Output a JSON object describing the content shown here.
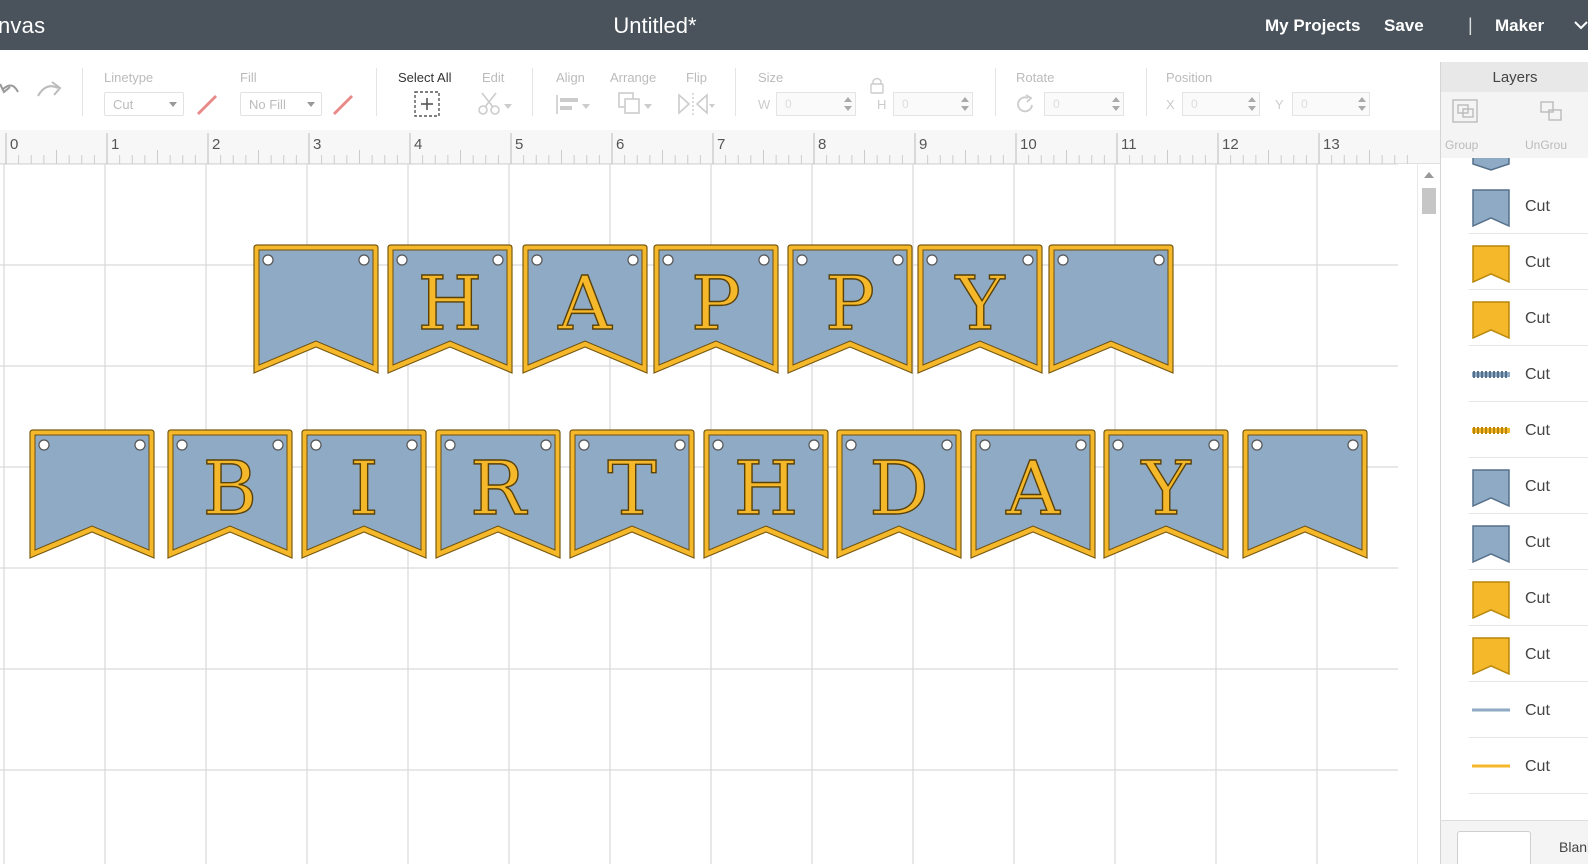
{
  "header": {
    "app_name": "nvas",
    "doc_title": "Untitled*",
    "my_projects": "My Projects",
    "save": "Save",
    "separator": "|",
    "machine": "Maker"
  },
  "toolbar": {
    "linetype_label": "Linetype",
    "linetype_value": "Cut",
    "fill_label": "Fill",
    "fill_value": "No Fill",
    "select_all_label": "Select All",
    "edit_label": "Edit",
    "align_label": "Align",
    "arrange_label": "Arrange",
    "flip_label": "Flip",
    "size_label": "Size",
    "w_label": "W",
    "h_label": "H",
    "rotate_label": "Rotate",
    "position_label": "Position",
    "x_label": "X",
    "y_label": "Y",
    "w_value": "0",
    "h_value": "0",
    "rotate_value": "0",
    "x_value": "0",
    "y_value": "0",
    "disabled_color": "#b9b9b9",
    "linetype_swatch_color": "#e88a8a"
  },
  "layers_panel": {
    "title": "Layers",
    "group_label": "Group",
    "ungroup_label": "UnGrou",
    "blank_label": "Blank",
    "rows": [
      {
        "operation": "Cut",
        "thumb": "blue-pennant"
      },
      {
        "operation": "Cut",
        "thumb": "gold-pennant"
      },
      {
        "operation": "Cut",
        "thumb": "gold-pennant"
      },
      {
        "operation": "Cut",
        "thumb": "blue-dots"
      },
      {
        "operation": "Cut",
        "thumb": "gold-dots"
      },
      {
        "operation": "Cut",
        "thumb": "blue-pennant"
      },
      {
        "operation": "Cut",
        "thumb": "blue-pennant"
      },
      {
        "operation": "Cut",
        "thumb": "gold-pennant"
      },
      {
        "operation": "Cut",
        "thumb": "gold-pennant"
      },
      {
        "operation": "Cut",
        "thumb": "blue-line"
      },
      {
        "operation": "Cut",
        "thumb": "gold-line"
      }
    ]
  },
  "ruler": {
    "numbers": [
      "0",
      "1",
      "2",
      "3",
      "4",
      "5",
      "6",
      "7",
      "8",
      "9",
      "10",
      "11",
      "12",
      "13"
    ]
  },
  "canvas": {
    "banner_row_1": [
      "",
      "H",
      "A",
      "P",
      "P",
      "Y",
      ""
    ],
    "banner_row_2": [
      "",
      "B",
      "I",
      "R",
      "T",
      "H",
      "D",
      "A",
      "Y",
      ""
    ],
    "pennant_color": "#8eaac4",
    "border_color": "#f5b82a",
    "grid_color": "#d9d9d9"
  }
}
